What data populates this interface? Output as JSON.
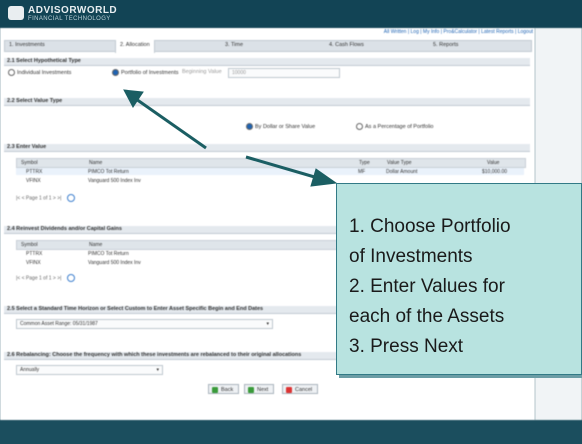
{
  "header": {
    "brand": "ADVISORWORLD",
    "brand_sub": "FINANCIAL TECHNOLOGY"
  },
  "toplinks": "All Written | Log | My Info | Pro&Calculator | Latest Reports | Logout",
  "tabs": [
    "1. Investments",
    "2. Allocation",
    "3. Time",
    "4. Cash Flows",
    "5. Reports"
  ],
  "sections": {
    "s1": {
      "title": "2.1 Select Hypothetical Type",
      "opt1": "Individual Investments",
      "opt2": "Portfolio of Investments",
      "beginning_label": "Beginning Value",
      "beginning_value": "10000"
    },
    "s2": {
      "title": "2.2 Select Value Type",
      "opt1": "By Dollar or Share Value",
      "opt2": "As a Percentage of Portfolio"
    },
    "s3": {
      "title": "2.3 Enter Value",
      "cols": [
        "Symbol",
        "Name",
        "Type",
        "Value Type",
        "Value"
      ],
      "rows": [
        [
          "PTTRX",
          "PIMCO Tot Return",
          "MF",
          "Dollar Amount",
          "$10,000.00"
        ],
        [
          "VFINX",
          "Vanguard 500 Index Inv",
          "",
          "",
          ""
        ]
      ],
      "pager": "Page 1 of 1"
    },
    "s4": {
      "title": "2.4 Reinvest Dividends and/or Capital Gains",
      "cols": [
        "Symbol",
        "Name"
      ],
      "rows": [
        [
          "PTTRX",
          "PIMCO Tot Return"
        ],
        [
          "VFINX",
          "Vanguard 500 Index Inv"
        ]
      ],
      "pager": "Page 1 of 1"
    },
    "s5": {
      "title": "2.5 Select a Standard Time Horizon or Select Custom to Enter Asset Specific Begin and End Dates",
      "value": "Common Asset Range: 05/31/1987"
    },
    "s6": {
      "title": "2.6 Rebalancing: Choose the frequency with which these investments are rebalanced to their original allocations",
      "value": "Annually"
    }
  },
  "buttons": {
    "back": "Back",
    "next": "Next",
    "cancel": "Cancel"
  },
  "callout": {
    "line1": "1. Choose Portfolio",
    "line2": "of Investments",
    "line3": "2. Enter Values for",
    "line4": "each of the Assets",
    "line5": "3. Press Next"
  },
  "colors": {
    "header": "#124455",
    "callout_bg": "#b8e3e0",
    "arrow": "#1b5e63"
  }
}
